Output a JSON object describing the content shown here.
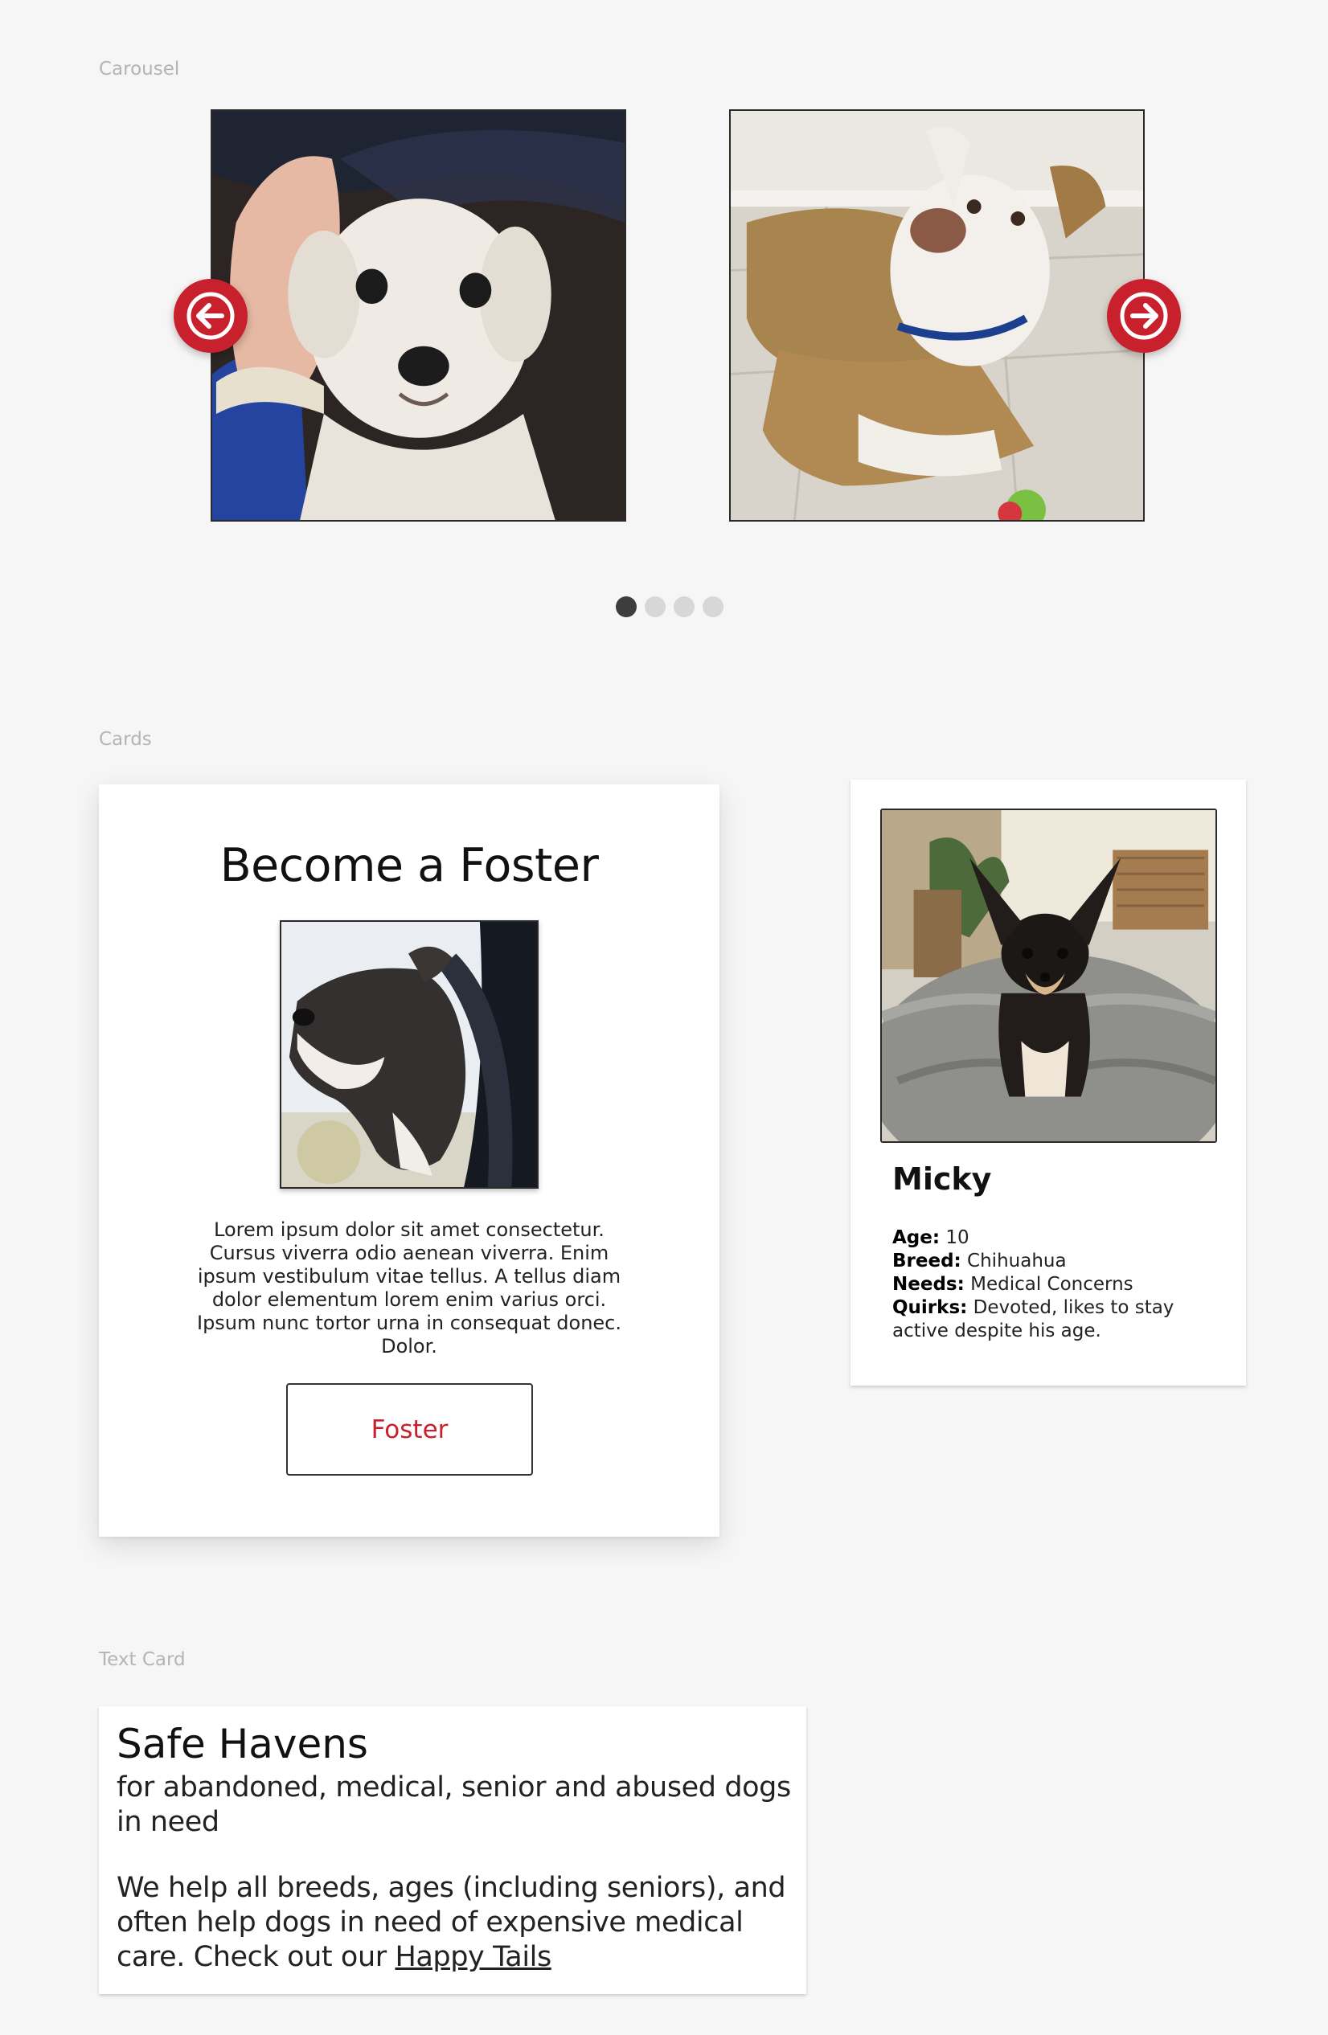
{
  "sections": {
    "carousel_label": "Carousel",
    "cards_label": "Cards",
    "text_card_label": "Text Card"
  },
  "carousel": {
    "slides": [
      {
        "icon": "dog-photo-white-terrier"
      },
      {
        "icon": "dog-photo-pitbull-mix"
      }
    ],
    "prev_icon": "arrow-left-icon",
    "next_icon": "arrow-right-icon",
    "dots_total": 4,
    "active_dot": 1,
    "accent_color": "#c8202d"
  },
  "foster_card": {
    "title": "Become a Foster",
    "photo_icon": "dog-in-car-window-photo",
    "text": "Lorem ipsum dolor sit amet consectetur. Cursus viverra odio aenean viverra. Enim ipsum vestibulum vitae tellus. A tellus diam dolor elementum lorem enim varius orci. Ipsum nunc tortor urna in consequat donec. Dolor.",
    "button_label": "Foster",
    "button_color": "#c8202d"
  },
  "dog_card": {
    "photo_icon": "chihuahua-photo",
    "name": "Micky",
    "age_label": "Age:",
    "age": "10",
    "breed_label": "Breed:",
    "breed": "Chihuahua",
    "needs_label": "Needs:",
    "needs": "Medical Concerns",
    "quirks_label": "Quirks:",
    "quirks": "Devoted, likes to stay active despite his age."
  },
  "text_card": {
    "title": "Safe Havens",
    "subtitle": "for abandoned, medical, senior and abused dogs in need",
    "body": "We help all breeds, ages (including seniors), and often help dogs in need of expensive medical care. Check out our",
    "link_text": "Happy Tails"
  }
}
